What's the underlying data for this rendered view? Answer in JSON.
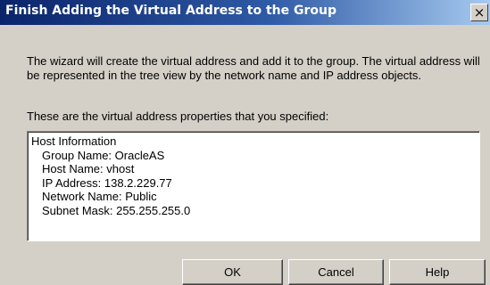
{
  "window": {
    "title": "Finish Adding the Virtual Address to the Group",
    "close_glyph": "×"
  },
  "intro_text": "The wizard will create the virtual address and add it to the group.  The virtual address will be represented in the tree view by the network name and IP address objects.",
  "subhead_text": "These are the virtual address properties that you specified:",
  "properties": {
    "heading": "Host Information",
    "lines": [
      "Group Name:  OracleAS",
      "Host Name:  vhost",
      "IP Address:  138.2.229.77",
      "Network Name:  Public",
      "Subnet Mask:  255.255.255.0"
    ]
  },
  "buttons": {
    "ok": "OK",
    "cancel": "Cancel",
    "help": "Help"
  }
}
